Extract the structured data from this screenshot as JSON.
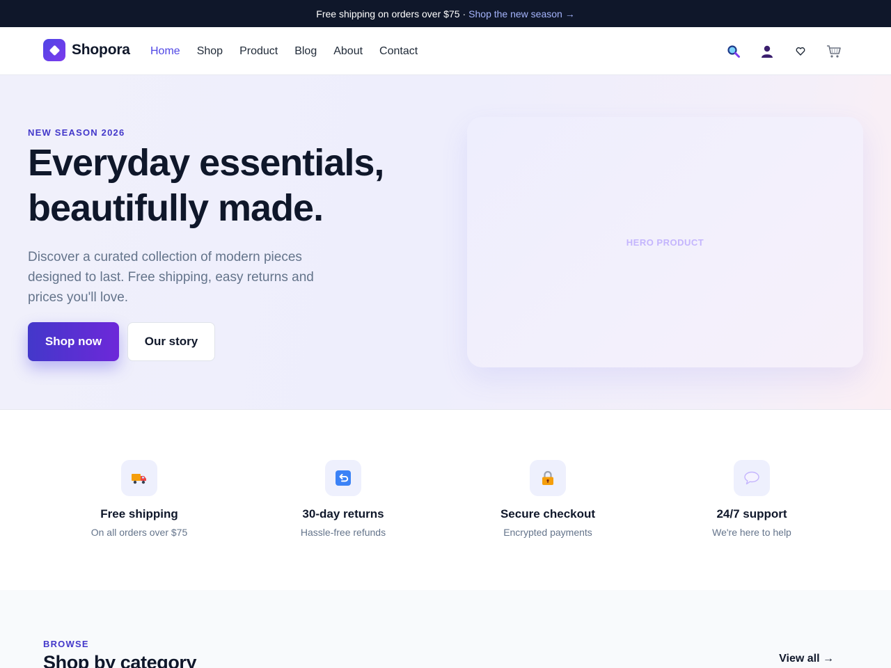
{
  "announcement": {
    "text": "Free shipping on orders over $75",
    "separator": "·",
    "link": "Shop the new season →"
  },
  "brand": {
    "name": "Shopora"
  },
  "nav": {
    "links": [
      "Home",
      "Shop",
      "Product",
      "Blog",
      "About",
      "Contact"
    ],
    "active": "Home",
    "icons": [
      "search-icon",
      "user-icon",
      "heart-icon",
      "cart-icon"
    ]
  },
  "hero": {
    "eyebrow": "NEW SEASON 2026",
    "title_line1": "Everyday essentials,",
    "title_line2": "beautifully made.",
    "subtitle": "Discover a curated collection of modern pieces designed to last. Free shipping, easy returns and prices you'll love.",
    "primary_cta": "Shop now",
    "secondary_cta": "Our story",
    "image_placeholder": "HERO PRODUCT"
  },
  "features": [
    {
      "icon": "truck-icon",
      "title": "Free shipping",
      "subtitle": "On all orders over $75"
    },
    {
      "icon": "return-icon",
      "title": "30-day returns",
      "subtitle": "Hassle-free refunds"
    },
    {
      "icon": "lock-icon",
      "title": "Secure checkout",
      "subtitle": "Encrypted payments"
    },
    {
      "icon": "chat-icon",
      "title": "24/7 support",
      "subtitle": "We're here to help"
    }
  ],
  "browse": {
    "eyebrow": "BROWSE",
    "title": "Shop by category",
    "view_all": "View all →"
  },
  "colors": {
    "accent": "#4f46e5",
    "dark": "#0f172a",
    "muted": "#64748b",
    "announce_link": "#a5b4fc"
  }
}
